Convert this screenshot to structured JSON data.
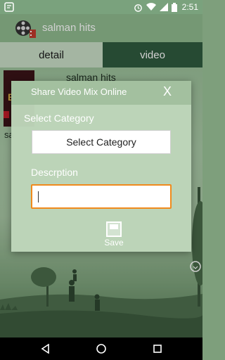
{
  "status_bar": {
    "time": "2:51",
    "icons": [
      "notification-icon",
      "alarm-icon",
      "wifi-icon",
      "signal-icon",
      "battery-icon"
    ]
  },
  "app_bar": {
    "title": "salman hits",
    "logo_icon": "film-reel-icon"
  },
  "tabs": [
    {
      "label": "detail",
      "selected": true
    },
    {
      "label": "video",
      "selected": false
    }
  ],
  "background": {
    "item_title": "salman hits",
    "item_caption": "sa",
    "thumbnail_text": "B"
  },
  "dialog": {
    "title": "Share Video Mix Online",
    "close_label": "X",
    "category_label": "Select Category",
    "category_button": "Select Category",
    "description_label": "Descrption",
    "description_value": "",
    "save_label": "Save",
    "accent": "#f08a1c"
  },
  "nav_bar": {
    "icons": [
      "back-icon",
      "home-icon",
      "recents-icon"
    ]
  }
}
